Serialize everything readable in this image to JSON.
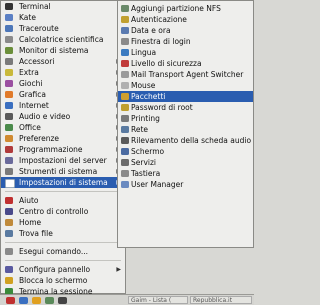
{
  "main_menu": {
    "items": [
      {
        "label": "Terminal",
        "icon": "terminal-icon",
        "color": "#333333",
        "has_sub": false
      },
      {
        "label": "Kate",
        "icon": "kate-icon",
        "color": "#5a7fc4",
        "has_sub": false
      },
      {
        "label": "Traceroute",
        "icon": "traceroute-icon",
        "color": "#4d77b8",
        "has_sub": false
      },
      {
        "label": "Calcolatrice scientifica",
        "icon": "calculator-icon",
        "color": "#8a8a8a",
        "has_sub": false
      },
      {
        "label": "Monitor di sistema",
        "icon": "monitor-icon",
        "color": "#6b8f3a",
        "has_sub": false
      },
      {
        "label": "Accessori",
        "icon": "accessories-icon",
        "color": "#7a7a7a",
        "has_sub": true
      },
      {
        "label": "Extra",
        "icon": "extra-icon",
        "color": "#c9b93a",
        "has_sub": true
      },
      {
        "label": "Giochi",
        "icon": "games-icon",
        "color": "#9a4fa0",
        "has_sub": true
      },
      {
        "label": "Grafica",
        "icon": "graphics-icon",
        "color": "#e07a2a",
        "has_sub": true
      },
      {
        "label": "Internet",
        "icon": "internet-icon",
        "color": "#3a6fc0",
        "has_sub": true
      },
      {
        "label": "Audio e video",
        "icon": "multimedia-icon",
        "color": "#5a5a5a",
        "has_sub": true
      },
      {
        "label": "Office",
        "icon": "office-icon",
        "color": "#4a8a4a",
        "has_sub": true
      },
      {
        "label": "Preferenze",
        "icon": "preferences-icon",
        "color": "#d08a30",
        "has_sub": true
      },
      {
        "label": "Programmazione",
        "icon": "programming-icon",
        "color": "#b03a3a",
        "has_sub": true
      },
      {
        "label": "Impostazioni del server",
        "icon": "server-settings-icon",
        "color": "#6a6a9a",
        "has_sub": true
      },
      {
        "label": "Strumenti di sistema",
        "icon": "system-tools-icon",
        "color": "#7a7a7a",
        "has_sub": true
      },
      {
        "label": "Impostazioni di sistema",
        "icon": "system-settings-icon",
        "color": "#ffffff",
        "has_sub": true,
        "selected": true
      }
    ],
    "items2": [
      {
        "label": "Aiuto",
        "icon": "help-icon",
        "color": "#c03030"
      },
      {
        "label": "Centro di controllo",
        "icon": "control-center-icon",
        "color": "#4a4a8a"
      },
      {
        "label": "Home",
        "icon": "home-icon",
        "color": "#c08a3a"
      },
      {
        "label": "Trova file",
        "icon": "find-files-icon",
        "color": "#5a7aa0"
      }
    ],
    "items3": [
      {
        "label": "Esegui comando...",
        "icon": "run-command-icon",
        "color": "#8a8a8a"
      }
    ],
    "items4": [
      {
        "label": "Configura pannello",
        "icon": "configure-panel-icon",
        "color": "#5a5aa0",
        "has_sub": true
      },
      {
        "label": "Blocca lo schermo",
        "icon": "lock-screen-icon",
        "color": "#d0a020"
      },
      {
        "label": "Termina la sessione",
        "icon": "logout-icon",
        "color": "#3a8a3a"
      }
    ]
  },
  "submenu": {
    "items": [
      {
        "label": "Aggiungi partizione NFS",
        "icon": "nfs-icon",
        "color": "#6a8a6a"
      },
      {
        "label": "Autenticazione",
        "icon": "authentication-icon",
        "color": "#c0a030"
      },
      {
        "label": "Data e ora",
        "icon": "date-time-icon",
        "color": "#5a7ab0"
      },
      {
        "label": "Finestra di login",
        "icon": "login-window-icon",
        "color": "#8a8a8a"
      },
      {
        "label": "Lingua",
        "icon": "language-icon",
        "color": "#3a7ac0"
      },
      {
        "label": "Livello di sicurezza",
        "icon": "security-level-icon",
        "color": "#c03a3a"
      },
      {
        "label": "Mail Transport Agent Switcher",
        "icon": "mail-icon",
        "color": "#9a9a9a"
      },
      {
        "label": "Mouse",
        "icon": "mouse-icon",
        "color": "#b0b0b0"
      },
      {
        "label": "Pacchetti",
        "icon": "packages-icon",
        "color": "#d0a030",
        "selected": true
      },
      {
        "label": "Password di root",
        "icon": "root-password-icon",
        "color": "#c0a030"
      },
      {
        "label": "Printing",
        "icon": "printer-icon",
        "color": "#7a7a7a"
      },
      {
        "label": "Rete",
        "icon": "network-icon",
        "color": "#5a7aa0"
      },
      {
        "label": "Rilevamento della scheda audio",
        "icon": "soundcard-icon",
        "color": "#5a5a5a"
      },
      {
        "label": "Schermo",
        "icon": "display-icon",
        "color": "#4a6aa0"
      },
      {
        "label": "Servizi",
        "icon": "services-icon",
        "color": "#6a6a6a"
      },
      {
        "label": "Tastiera",
        "icon": "keyboard-icon",
        "color": "#8a8a8a"
      },
      {
        "label": "User Manager",
        "icon": "user-manager-icon",
        "color": "#6a8ac0"
      }
    ]
  },
  "taskbar": {
    "launchers": [
      {
        "icon": "main-menu-icon",
        "color": "#c03030"
      },
      {
        "icon": "browser-icon",
        "color": "#3a6fc0"
      },
      {
        "icon": "mail-icon",
        "color": "#e0a020"
      },
      {
        "icon": "files-icon",
        "color": "#5a8a5a"
      },
      {
        "icon": "terminal-icon",
        "color": "#444444"
      }
    ],
    "windows": [
      "Gaim - Lista (",
      "Repubblica.it"
    ]
  }
}
